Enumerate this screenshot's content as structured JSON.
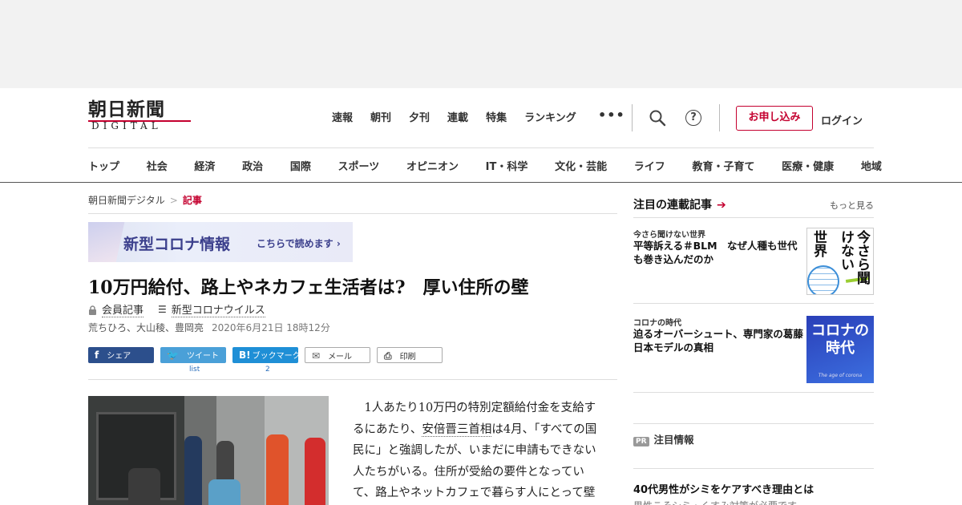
{
  "header": {
    "logo_main": "朝日新聞",
    "logo_sub": "DIGITAL",
    "top_nav": [
      "速報",
      "朝刊",
      "夕刊",
      "連載",
      "特集",
      "ランキング"
    ],
    "more": "•••",
    "help": "?",
    "apply": "お申し込み",
    "login": "ログイン"
  },
  "categories": [
    "トップ",
    "社会",
    "経済",
    "政治",
    "国際",
    "スポーツ",
    "オピニオン",
    "IT・科学",
    "文化・芸能",
    "ライフ",
    "教育・子育て",
    "医療・健康",
    "地域"
  ],
  "breadcrumb": {
    "home": "朝日新聞デジタル",
    "sep": ">",
    "current": "記事"
  },
  "banner": {
    "title": "新型コロナ情報",
    "link": "こちらで読めます ›"
  },
  "article": {
    "headline": "10万円給付、路上やネカフェ生活者は?　厚い住所の壁",
    "member": "会員記事",
    "topic": "新型コロナウイルス",
    "authors": "荒ちひろ、大山稜、豊岡亮",
    "date": "2020年6月21日 18時12分",
    "body_pre": "　1人あたり10万円の特別定額給付金を支給するにあたり、",
    "body_link": "安倍晋三首相",
    "body_post": "は4月、「すべての国民に」と強調したが、いまだに申請もできない人たちがいる。住所が受給の要件となっていて、路上やネットカフェで暮らす人にとって壁になるからだ。"
  },
  "share": {
    "facebook": "シェア",
    "twitter": "ツイート",
    "twitter_count": "list",
    "hatena_icon": "B!",
    "hatena": "ブックマーク",
    "hatena_count": "2",
    "mail": "メール",
    "print": "印刷"
  },
  "sidebar": {
    "heading": "注目の連載記事",
    "more": "もっと見る",
    "items": [
      {
        "kicker": "今さら聞けない世界",
        "title": "平等訴える＃BLM　なぜ人種も世代も巻き込んだのか",
        "thumb_a": "世界",
        "thumb_b": "今さら聞けない"
      },
      {
        "kicker": "コロナの時代",
        "title": "迫るオーバーシュート、専門家の葛藤　日本モデルの真相",
        "thumb_title": "コロナの時代",
        "thumb_sub": "The age of corona"
      }
    ],
    "pr_badge": "PR",
    "pr_heading": "注目情報",
    "pr_title": "40代男性がシミをケアすべき理由とは",
    "pr_sub": "男性こそシミ・くすみ対策が必要です"
  },
  "colors": {
    "brand_red": "#c4002f",
    "facebook": "#2c4f8c",
    "twitter": "#4aa0d8",
    "hatena": "#1f8fd6"
  }
}
